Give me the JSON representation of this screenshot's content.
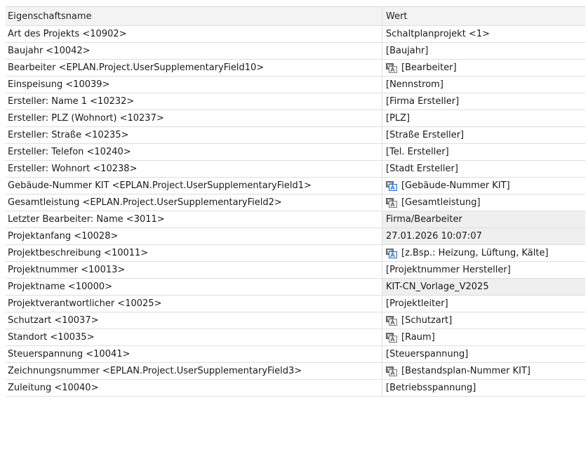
{
  "header": {
    "col_name": "Eigenschaftsname",
    "col_value": "Wert"
  },
  "rows": [
    {
      "name": "Art des Projekts <10902>",
      "value": "Schaltplanprojekt <1>",
      "icon": "",
      "readonly": false
    },
    {
      "name": "Baujahr <10042>",
      "value": "[Baujahr]",
      "icon": "",
      "readonly": false
    },
    {
      "name": "Bearbeiter <EPLAN.Project.UserSupplementaryField10>",
      "value": "[Bearbeiter]",
      "icon": "language-icon",
      "readonly": false
    },
    {
      "name": "Einspeisung <10039>",
      "value": "[Nennstrom]",
      "icon": "",
      "readonly": false
    },
    {
      "name": "Ersteller: Name 1 <10232>",
      "value": "[Firma Ersteller]",
      "icon": "",
      "readonly": false
    },
    {
      "name": "Ersteller: PLZ (Wohnort) <10237>",
      "value": "[PLZ]",
      "icon": "",
      "readonly": false
    },
    {
      "name": "Ersteller: Straße <10235>",
      "value": "[Straße Ersteller]",
      "icon": "",
      "readonly": false
    },
    {
      "name": "Ersteller: Telefon <10240>",
      "value": "[Tel. Ersteller]",
      "icon": "",
      "readonly": false
    },
    {
      "name": "Ersteller: Wohnort <10238>",
      "value": "[Stadt Ersteller]",
      "icon": "",
      "readonly": false
    },
    {
      "name": "Gebäude-Nummer KIT <EPLAN.Project.UserSupplementaryField1>",
      "value": "[Gebäude-Nummer KIT]",
      "icon": "language-multi-icon",
      "readonly": false
    },
    {
      "name": "Gesamtleistung <EPLAN.Project.UserSupplementaryField2>",
      "value": "[Gesamtleistung]",
      "icon": "language-icon",
      "readonly": false
    },
    {
      "name": "Letzter Bearbeiter: Name <3011>",
      "value": "Firma/Bearbeiter",
      "icon": "",
      "readonly": true
    },
    {
      "name": "Projektanfang <10028>",
      "value": "27.01.2026 10:07:07",
      "icon": "",
      "readonly": true
    },
    {
      "name": "Projektbeschreibung <10011>",
      "value": "[z.Bsp.: Heizung, Lüftung, Kälte]",
      "icon": "language-multi-icon",
      "readonly": false
    },
    {
      "name": "Projektnummer <10013>",
      "value": "[Projektnummer Hersteller]",
      "icon": "",
      "readonly": false
    },
    {
      "name": "Projektname <10000>",
      "value": "KIT-CN_Vorlage_V2025",
      "icon": "",
      "readonly": true
    },
    {
      "name": "Projektverantwortlicher <10025>",
      "value": "[Projektleiter]",
      "icon": "",
      "readonly": false
    },
    {
      "name": "Schutzart <10037>",
      "value": "[Schutzart]",
      "icon": "language-icon",
      "readonly": false
    },
    {
      "name": "Standort <10035>",
      "value": "[Raum]",
      "icon": "language-icon",
      "readonly": false
    },
    {
      "name": "Steuerspannung <10041>",
      "value": "[Steuerspannung]",
      "icon": "",
      "readonly": false
    },
    {
      "name": "Zeichnungsnummer <EPLAN.Project.UserSupplementaryField3>",
      "value": "[Bestandsplan-Nummer KIT]",
      "icon": "language-icon",
      "readonly": false
    },
    {
      "name": "Zuleitung <10040>",
      "value": "[Betriebsspannung]",
      "icon": "",
      "readonly": false
    }
  ]
}
